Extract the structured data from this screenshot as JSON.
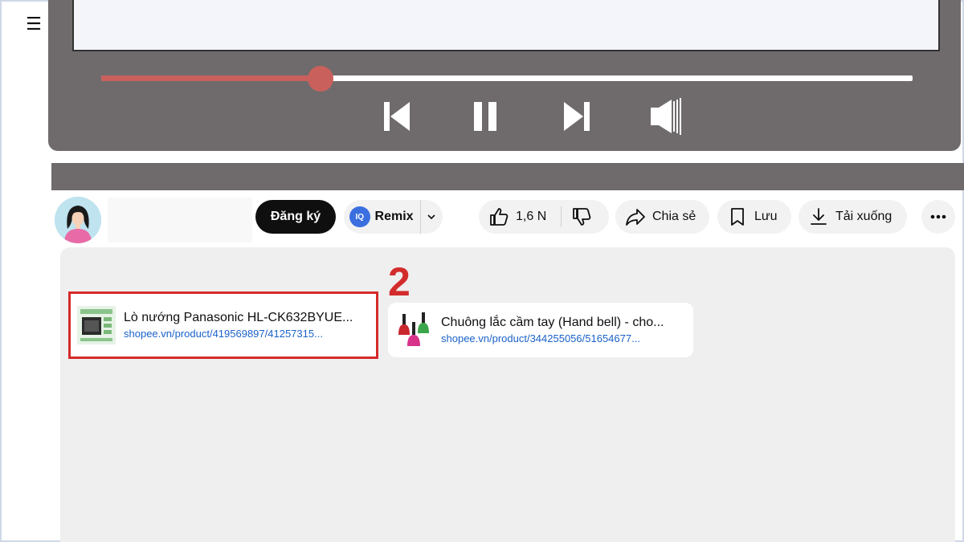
{
  "menu": {
    "icon": "hamburger-menu-icon",
    "glyph": "☰"
  },
  "player": {
    "progress_fraction": 0.27,
    "colors": {
      "background": "#6f6b6c",
      "progress": "#c9605c",
      "track": "#ffffff"
    },
    "controls": [
      "previous-icon",
      "pause-icon",
      "next-icon",
      "volume-icon"
    ]
  },
  "channel": {
    "avatar_icon": "woman-avatar-icon",
    "subscribe_label": "Đăng ký",
    "remix": {
      "badge": "IQ",
      "label": "Remix"
    },
    "likes_label": "1,6 N",
    "share_label": "Chia sẻ",
    "save_label": "Lưu",
    "download_label": "Tải xuống"
  },
  "description": {
    "step_number": "2",
    "step_color": "#d32c2c",
    "products": [
      {
        "title": "Lò nướng Panasonic HL-CK632BYUE...",
        "url": "shopee.vn/product/419569897/41257315...",
        "thumb_icon": "oven-product-thumbnail"
      },
      {
        "title": "Chuông lắc cầm tay (Hand bell) - cho...",
        "url": "shopee.vn/product/344255056/51654677...",
        "thumb_icon": "hand-bell-product-thumbnail"
      }
    ]
  }
}
